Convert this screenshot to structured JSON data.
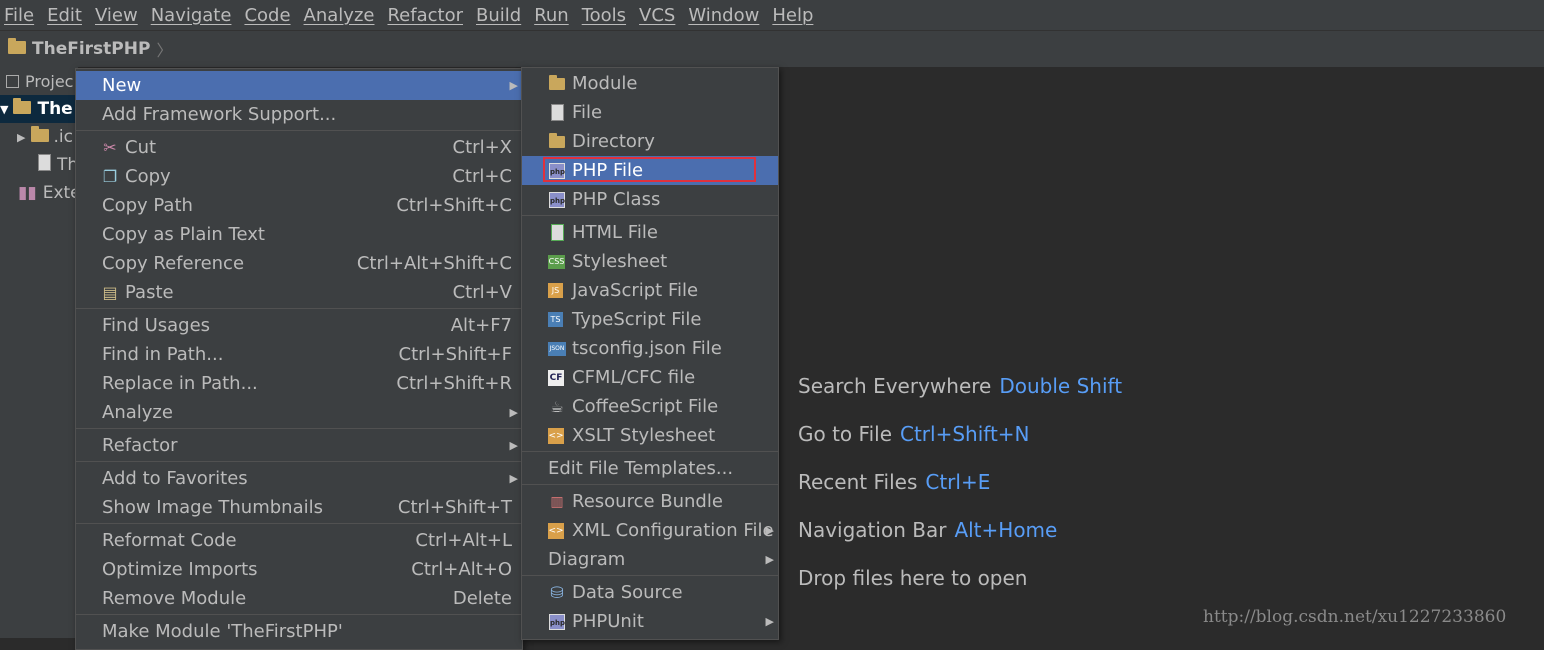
{
  "menubar": [
    "File",
    "Edit",
    "View",
    "Navigate",
    "Code",
    "Analyze",
    "Refactor",
    "Build",
    "Run",
    "Tools",
    "VCS",
    "Window",
    "Help"
  ],
  "navbar": {
    "project": "TheFirstPHP"
  },
  "project_panel": {
    "header": "Projec",
    "rows": [
      "The",
      ".ic",
      "Th",
      "Exte"
    ]
  },
  "context_menu": {
    "items": [
      {
        "label": "New",
        "shortcut": "",
        "submenu": true
      },
      {
        "label": "Add Framework Support...",
        "shortcut": ""
      },
      {
        "label": "Cut",
        "shortcut": "Ctrl+X",
        "icon": "scissors-icon"
      },
      {
        "label": "Copy",
        "shortcut": "Ctrl+C",
        "icon": "copy-icon"
      },
      {
        "label": "Copy Path",
        "shortcut": "Ctrl+Shift+C"
      },
      {
        "label": "Copy as Plain Text",
        "shortcut": ""
      },
      {
        "label": "Copy Reference",
        "shortcut": "Ctrl+Alt+Shift+C"
      },
      {
        "label": "Paste",
        "shortcut": "Ctrl+V",
        "icon": "paste-icon"
      },
      {
        "label": "Find Usages",
        "shortcut": "Alt+F7"
      },
      {
        "label": "Find in Path...",
        "shortcut": "Ctrl+Shift+F"
      },
      {
        "label": "Replace in Path...",
        "shortcut": "Ctrl+Shift+R"
      },
      {
        "label": "Analyze",
        "shortcut": "",
        "submenu": true
      },
      {
        "label": "Refactor",
        "shortcut": "",
        "submenu": true
      },
      {
        "label": "Add to Favorites",
        "shortcut": "",
        "submenu": true
      },
      {
        "label": "Show Image Thumbnails",
        "shortcut": "Ctrl+Shift+T"
      },
      {
        "label": "Reformat Code",
        "shortcut": "Ctrl+Alt+L"
      },
      {
        "label": "Optimize Imports",
        "shortcut": "Ctrl+Alt+O"
      },
      {
        "label": "Remove Module",
        "shortcut": "Delete"
      },
      {
        "label": "Make Module 'TheFirstPHP'",
        "shortcut": ""
      }
    ]
  },
  "new_submenu": {
    "items": [
      {
        "label": "Module",
        "icon": "module-icon"
      },
      {
        "label": "File",
        "icon": "file-icon"
      },
      {
        "label": "Directory",
        "icon": "folder-icon"
      },
      {
        "label": "PHP File",
        "icon": "php-file-icon"
      },
      {
        "label": "PHP Class",
        "icon": "php-class-icon"
      },
      {
        "label": "HTML File",
        "icon": "html-file-icon"
      },
      {
        "label": "Stylesheet",
        "icon": "css-icon"
      },
      {
        "label": "JavaScript File",
        "icon": "js-icon"
      },
      {
        "label": "TypeScript File",
        "icon": "ts-icon"
      },
      {
        "label": "tsconfig.json File",
        "icon": "json-icon"
      },
      {
        "label": "CFML/CFC file",
        "icon": "cf-icon"
      },
      {
        "label": "CoffeeScript File",
        "icon": "coffee-icon"
      },
      {
        "label": "XSLT Stylesheet",
        "icon": "xslt-icon"
      },
      {
        "label": "Edit File Templates..."
      },
      {
        "label": "Resource Bundle",
        "icon": "resource-bundle-icon"
      },
      {
        "label": "XML Configuration File",
        "icon": "xml-icon",
        "submenu": true
      },
      {
        "label": "Diagram",
        "submenu": true
      },
      {
        "label": "Data Source",
        "icon": "database-icon"
      },
      {
        "label": "PHPUnit",
        "icon": "phpunit-icon",
        "submenu": true
      }
    ]
  },
  "welcome_hints": [
    {
      "text": "Search Everywhere",
      "key": "Double Shift"
    },
    {
      "text": "Go to File",
      "key": "Ctrl+Shift+N"
    },
    {
      "text": "Recent Files",
      "key": "Ctrl+E"
    },
    {
      "text": "Navigation Bar",
      "key": "Alt+Home"
    },
    {
      "text": "Drop files here to open",
      "key": ""
    }
  ],
  "watermark": "http://blog.csdn.net/xu1227233860",
  "colors": {
    "highlight": "#4b6eaf",
    "link": "#589df6",
    "redbox": "#e0313d"
  }
}
